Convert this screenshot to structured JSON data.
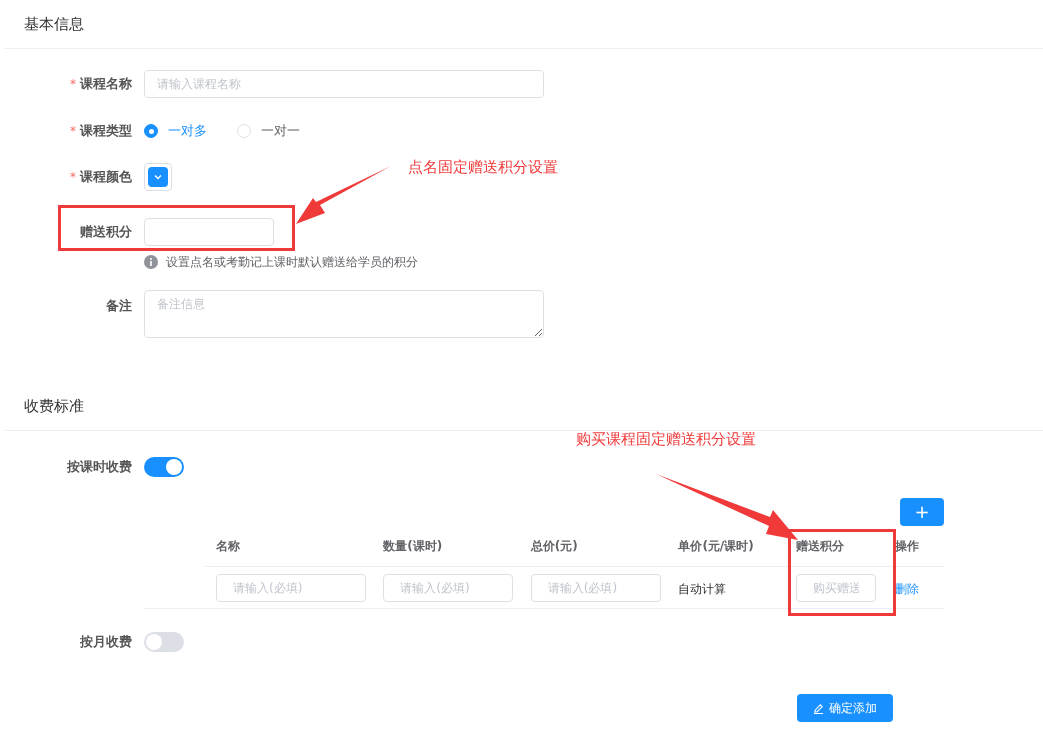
{
  "basic_info": {
    "title": "基本信息",
    "fields": [
      {
        "kind": "text",
        "required_mark": "*",
        "label": "课程名称",
        "placeholder": "请输入课程名称"
      },
      {
        "kind": "radio",
        "required_mark": "*",
        "label": "课程类型",
        "options": [
          {
            "label": "一对多",
            "selected": true
          },
          {
            "label": "一对一",
            "selected": false
          }
        ]
      },
      {
        "kind": "color",
        "required_mark": "*",
        "label": "课程颜色",
        "color": "#1890ff"
      },
      {
        "kind": "short",
        "label": "赠送积分",
        "hint": "设置点名或考勤记上课时默认赠送给学员的积分"
      },
      {
        "kind": "textarea",
        "label": "备注",
        "placeholder": "备注信息"
      }
    ]
  },
  "fees": {
    "title": "收费标准",
    "per_lesson": {
      "label": "按课时收费",
      "on": true
    },
    "add_button": "+",
    "table": {
      "columns": [
        "名称",
        "数量(课时)",
        "总价(元)",
        "单价(元/课时)",
        "赠送积分",
        "操作"
      ],
      "rows": [
        {
          "name_placeholder": "请输入(必填)",
          "quantity_placeholder": "请输入(必填)",
          "total_placeholder": "请输入(必填)",
          "unit_price": "自动计算",
          "points_placeholder": "购买赠送",
          "action": "删除"
        }
      ]
    },
    "monthly": {
      "label": "按月收费",
      "on": false
    }
  },
  "submit_button": "确定添加",
  "annotations": [
    {
      "text": "点名固定赠送积分设置"
    },
    {
      "text": "购买课程固定赠送积分设置"
    }
  ]
}
